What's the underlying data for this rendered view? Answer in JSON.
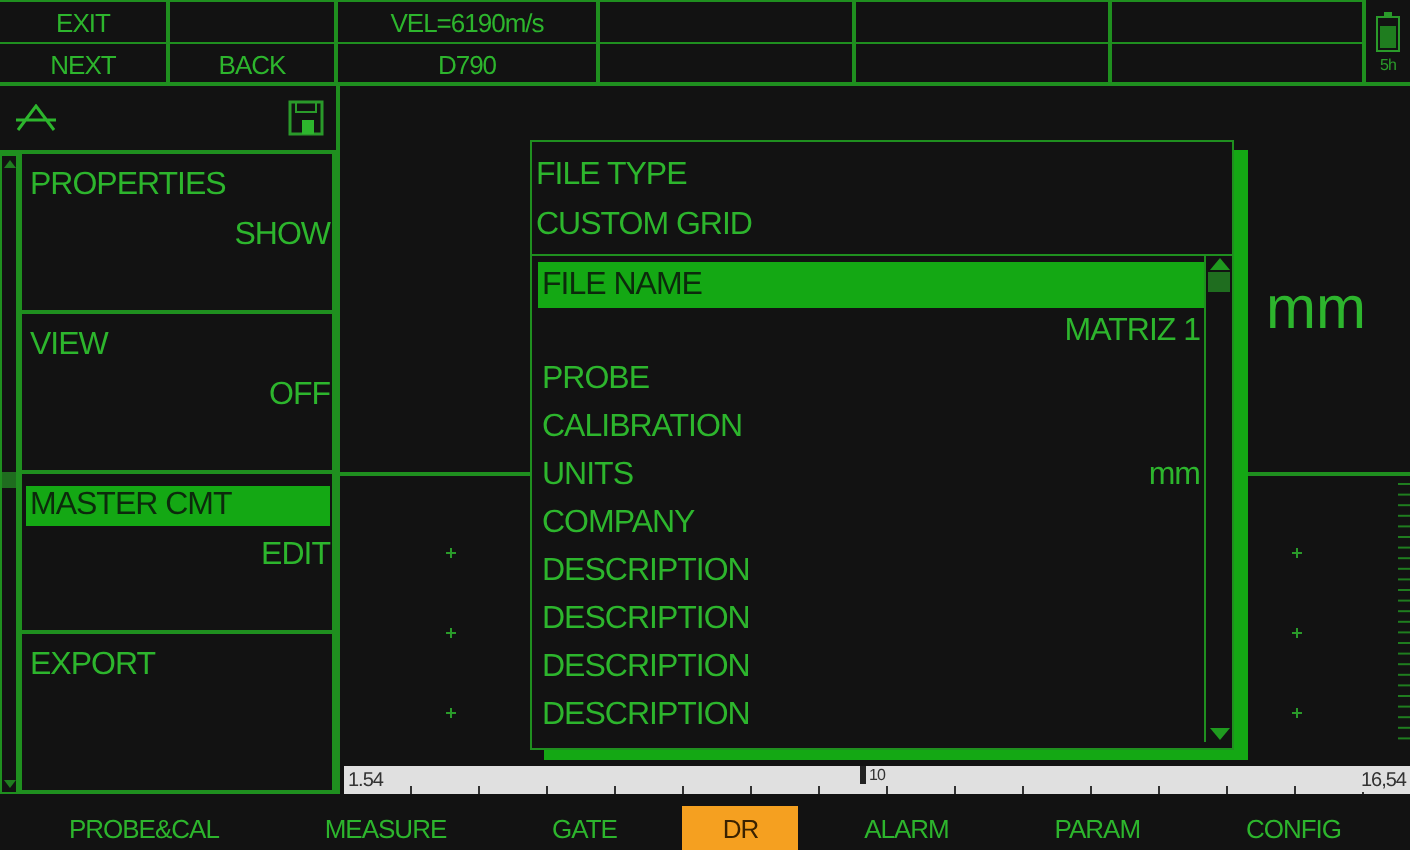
{
  "header": {
    "exit_button": "EXIT",
    "next_button": "NEXT",
    "back_button": "BACK",
    "velocity": "VEL=6190m/s",
    "probe": "D790",
    "battery": "5h"
  },
  "sidebar": {
    "items": [
      {
        "label": "PROPERTIES",
        "value": "SHOW",
        "selected": false
      },
      {
        "label": "VIEW",
        "value": "OFF",
        "selected": false
      },
      {
        "label": "MASTER CMT",
        "value": "EDIT",
        "selected": true
      },
      {
        "label": "EXPORT",
        "selected": false
      }
    ]
  },
  "dialog": {
    "header_items": [
      "FILE TYPE",
      "CUSTOM GRID"
    ],
    "items": [
      {
        "kind": "field",
        "label": "FILE NAME",
        "value": "MATRIZ 1",
        "selected": true
      },
      {
        "kind": "row",
        "label": "PROBE",
        "selected": false
      },
      {
        "kind": "row",
        "label": "CALIBRATION",
        "selected": false
      },
      {
        "kind": "row",
        "label": "UNITS",
        "value": "mm",
        "selected": false
      },
      {
        "kind": "row",
        "label": "COMPANY",
        "selected": false
      },
      {
        "kind": "row",
        "label": "DESCRIPTION",
        "selected": false
      },
      {
        "kind": "row",
        "label": "DESCRIPTION",
        "selected": false
      },
      {
        "kind": "row",
        "label": "DESCRIPTION",
        "selected": false
      },
      {
        "kind": "row",
        "label": "DESCRIPTION",
        "selected": false
      }
    ]
  },
  "unit_display": "mm",
  "ruler": {
    "start": "1.54",
    "middle": "10",
    "end": "16,54"
  },
  "tabs": [
    {
      "label": "PROBE&CAL",
      "selected": false
    },
    {
      "label": "MEASURE",
      "selected": false
    },
    {
      "label": "GATE",
      "selected": false
    },
    {
      "label": "DR",
      "selected": true
    },
    {
      "label": "ALARM",
      "selected": false
    },
    {
      "label": "PARAM",
      "selected": false
    },
    {
      "label": "CONFIG",
      "selected": false
    }
  ]
}
